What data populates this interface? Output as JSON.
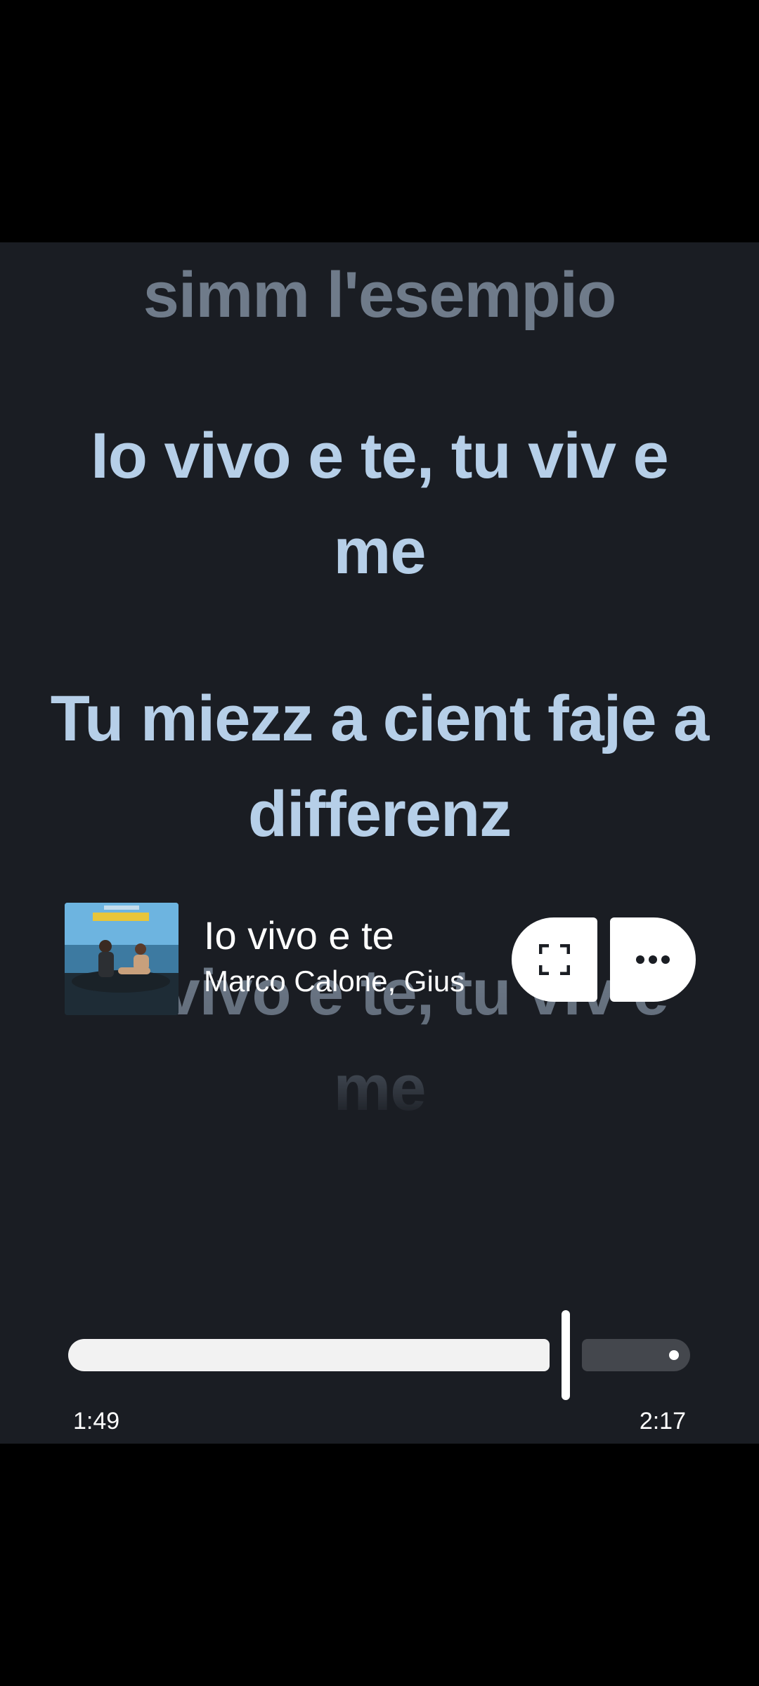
{
  "lyrics": {
    "previous": "simm l'esempio",
    "current_1": "Io vivo e te, tu viv e me",
    "current_2": "Tu miezz a cient faje a differenz",
    "next": "Io vivo e te, tu viv e me"
  },
  "now_playing": {
    "title": "Io vivo e te",
    "artist": "Marco Calone, Gius",
    "album_art_icon": "album-cover-image"
  },
  "controls": {
    "fullscreen_icon": "fullscreen-icon",
    "more_icon": "more-options-icon"
  },
  "playback": {
    "elapsed": "1:49",
    "duration": "2:17",
    "progress_fraction": 0.795
  },
  "colors": {
    "panel_background": "#1a1d23",
    "active_lyric": "#b6cfe8",
    "inactive_lyric": "#6f7b8a",
    "button_background": "#ffffff"
  }
}
